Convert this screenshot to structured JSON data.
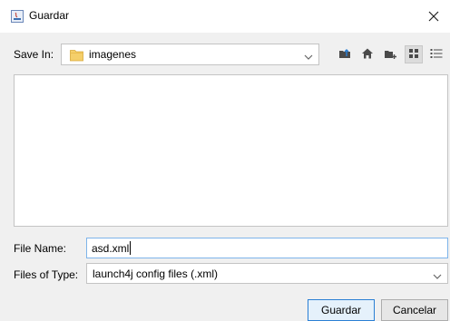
{
  "window": {
    "title": "Guardar",
    "icons": {
      "app": "java-app-icon",
      "close": "close-icon"
    }
  },
  "toolbar": {
    "save_in_label": "Save In:",
    "save_in_value": "imagenes",
    "icons": [
      "up-folder-icon",
      "home-icon",
      "new-folder-icon",
      "list-view-icon",
      "details-view-icon"
    ],
    "selected_view": "list-view-icon"
  },
  "form": {
    "file_name_label": "File Name:",
    "file_name_value": "asd.xml",
    "files_of_type_label": "Files of Type:",
    "files_of_type_value": "launch4j config files (.xml)"
  },
  "buttons": {
    "save_label": "Guardar",
    "cancel_label": "Cancelar"
  },
  "colors": {
    "folder": "#f5cf6a",
    "focus_border": "#7eb4ea",
    "default_button_border": "#2a7fd4",
    "icon": "#4a4a4a"
  }
}
